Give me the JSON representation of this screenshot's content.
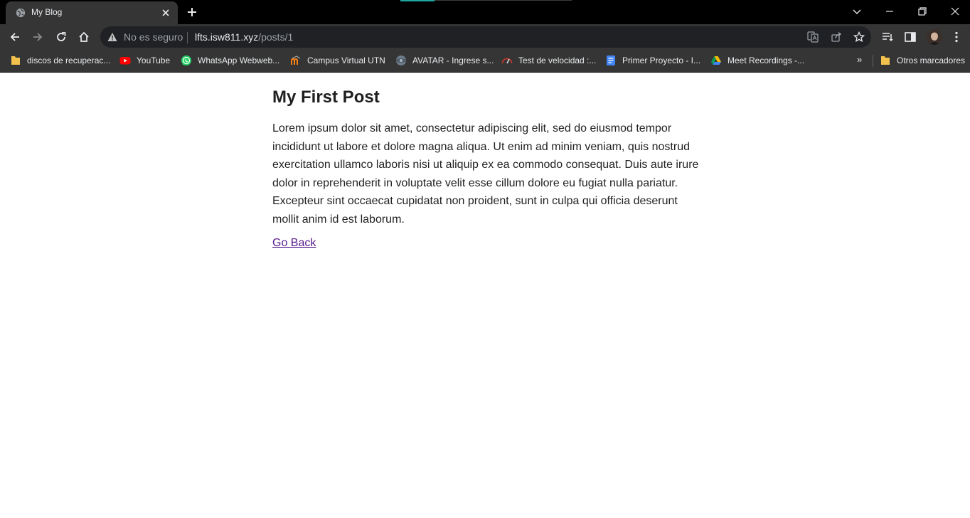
{
  "browser": {
    "tab": {
      "title": "My Blog"
    },
    "address": {
      "security_label": "No es seguro",
      "host": "lfts.isw811.xyz",
      "path": "/posts/1"
    },
    "bookmarks": [
      {
        "label": "discos de recuperac...",
        "icon": "folder-icon",
        "color": "#f2c14e"
      },
      {
        "label": "YouTube",
        "icon": "youtube-icon",
        "color": "#ff0000"
      },
      {
        "label": "WhatsApp Webweb...",
        "icon": "whatsapp-icon",
        "color": "#25d366"
      },
      {
        "label": "Campus Virtual UTN",
        "icon": "moodle-icon",
        "color": "#f98012"
      },
      {
        "label": "AVATAR - Ingrese s...",
        "icon": "avatar-site-icon",
        "color": "#6d7b8a"
      },
      {
        "label": "Test de velocidad :...",
        "icon": "speedtest-icon",
        "color": "#c0392b"
      },
      {
        "label": "Primer Proyecto - I...",
        "icon": "google-docs-icon",
        "color": "#4285f4"
      },
      {
        "label": "Meet Recordings -...",
        "icon": "google-drive-icon",
        "color": "#0f9d58"
      }
    ],
    "more_bookmarks": "»",
    "other_bookmarks": "Otros marcadores"
  },
  "page": {
    "title": "My First Post",
    "body": "Lorem ipsum dolor sit amet, consectetur adipiscing elit, sed do eiusmod tempor incididunt ut labore et dolore magna aliqua. Ut enim ad minim veniam, quis nostrud exercitation ullamco laboris nisi ut aliquip ex ea commodo consequat. Duis aute irure dolor in reprehenderit in voluptate velit esse cillum dolore eu fugiat nulla pariatur. Excepteur sint occaecat cupidatat non proident, sunt in culpa qui officia deserunt mollit anim id est laborum.",
    "back_link": "Go Back"
  },
  "colors": {
    "chrome_dark": "#353535",
    "link_visited": "#551a8b"
  }
}
